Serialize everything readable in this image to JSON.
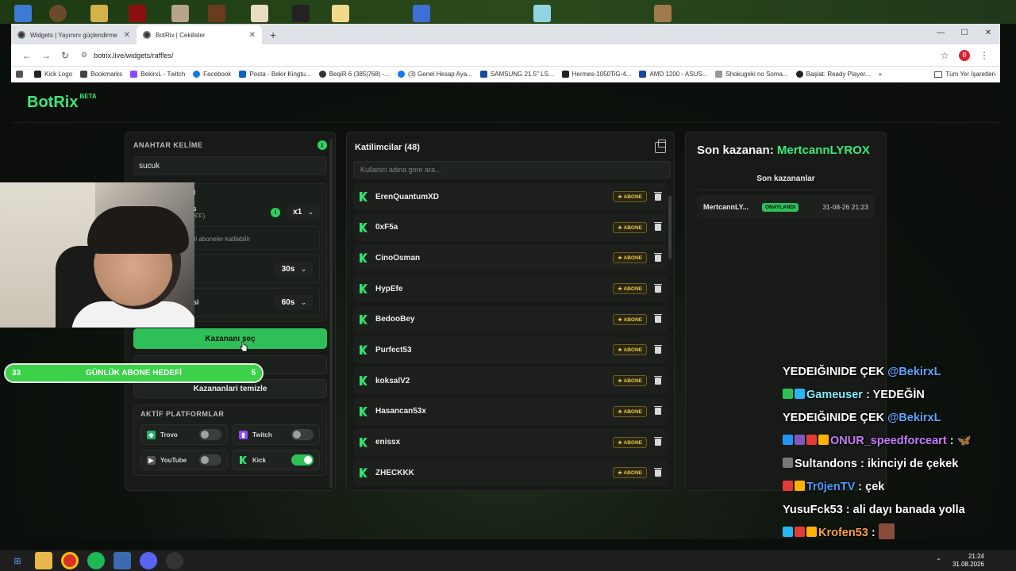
{
  "browser": {
    "tabs": [
      {
        "label": "Widgets | Yayınını güçlendirme",
        "active": false
      },
      {
        "label": "BotRix | Cekilisler",
        "active": true
      }
    ],
    "url": "botrix.live/widgets/raffles/",
    "bookmarks": [
      "Kick Logo",
      "Bookmarks",
      "BekirxL - Twitch",
      "Facebook",
      "Posta - Bekir Kingtu...",
      "BeqiR 6 (385|768) -...",
      "(3) Genel Hesap Aya...",
      "SAMSUNG 21.5\" LS...",
      "Hermes-1050TiG-4...",
      "AMD 1200 - ASUS...",
      "Shokugeki no Soma...",
      "Başlat: Ready Player..."
    ],
    "bookmarks_all": "Tüm Yer İşaretleri",
    "profile_initial": "B"
  },
  "app": {
    "brand": "BotRix",
    "beta": "BETA"
  },
  "left": {
    "keyword_title": "ANAHTAR KELİME",
    "keyword_value": "sucuk",
    "partial_title": "RI",
    "bonus_label": "us",
    "bonus_sub": "(OFF)",
    "multiplier": "x1",
    "subs_note": "etli aboneler katilabilir",
    "timer1": "30s",
    "timer2_label": "esi",
    "timer2": "60s",
    "pick_button": "Kazananı seç",
    "clear_button": "Kazananlari temizle",
    "platforms_title": "AKTİF PLATFORMLAR",
    "platforms": [
      {
        "name": "Trovo",
        "on": false,
        "color": "#1fb36b"
      },
      {
        "name": "Twitch",
        "on": false,
        "color": "#9146ff"
      },
      {
        "name": "YouTube",
        "on": false,
        "color": "#555555"
      },
      {
        "name": "Kick",
        "on": true,
        "color": "#35e06f"
      }
    ]
  },
  "participants": {
    "title": "Katilimcilar (48)",
    "search_placeholder": "Kullanici adina gore ara...",
    "badge": "★ ABONE",
    "users": [
      "ErenQuantumXD",
      "0xF5a",
      "CinoOsman",
      "HypEfe",
      "BedooBey",
      "Purfect53",
      "koksalV2",
      "Hasancan53x",
      "enissx",
      "ZHECKKK"
    ]
  },
  "winners": {
    "last_label": "Son kazanan:",
    "last_name": "MertcannLYROX",
    "recent_title": "Son kazananlar",
    "rows": [
      {
        "name": "MertcannLY...",
        "status": "ONAYLANDI",
        "date": "31-08-26 21:23"
      }
    ]
  },
  "goal": {
    "left": "33",
    "text": "GÜNLÜK ABONE HEDEFİ",
    "right": "5",
    "progress": 1.0
  },
  "chat": [
    {
      "user": "",
      "text": "YEDEIĞINIDE ÇEK ",
      "mention": "@BekirxL",
      "badges": []
    },
    {
      "user": "Gameuser",
      "user_color": "#7ff0ff",
      "text": " : YEDEĞİN",
      "mention": "",
      "badges": [
        "#2fbf59",
        "#29b6f6"
      ]
    },
    {
      "user": "",
      "text": "YEDEIĞINIDE ÇEK ",
      "mention": "@BekirxL",
      "badges": []
    },
    {
      "user": "ONUR_speedforceart",
      "user_color": "#c77dff",
      "text": " : 🦋",
      "mention": "",
      "badges": [
        "#2196f3",
        "#7e57c2",
        "#e53935",
        "#ffb300"
      ]
    },
    {
      "user": "Sultandons",
      "user_color": "#ffffff",
      "text": " : ikinciyi de çekek",
      "mention": "",
      "badges": [
        "#777777"
      ]
    },
    {
      "user": "Tr0jenTV",
      "user_color": "#4f9cff",
      "text": " : çek",
      "mention": "",
      "badges": [
        "#e53935",
        "#ffb300"
      ]
    },
    {
      "user": "YusuFck53",
      "user_color": "#ffffff",
      "text": " : ali dayı banada yolla",
      "mention": "",
      "badges": []
    },
    {
      "user": "Krofen53",
      "user_color": "#ff9f43",
      "text": " : ",
      "mention": "",
      "badges": [
        "#29b6f6",
        "#e53935",
        "#ffb300"
      ]
    }
  ],
  "taskbar": {
    "time": "21:24",
    "date": "31.08.2026"
  }
}
